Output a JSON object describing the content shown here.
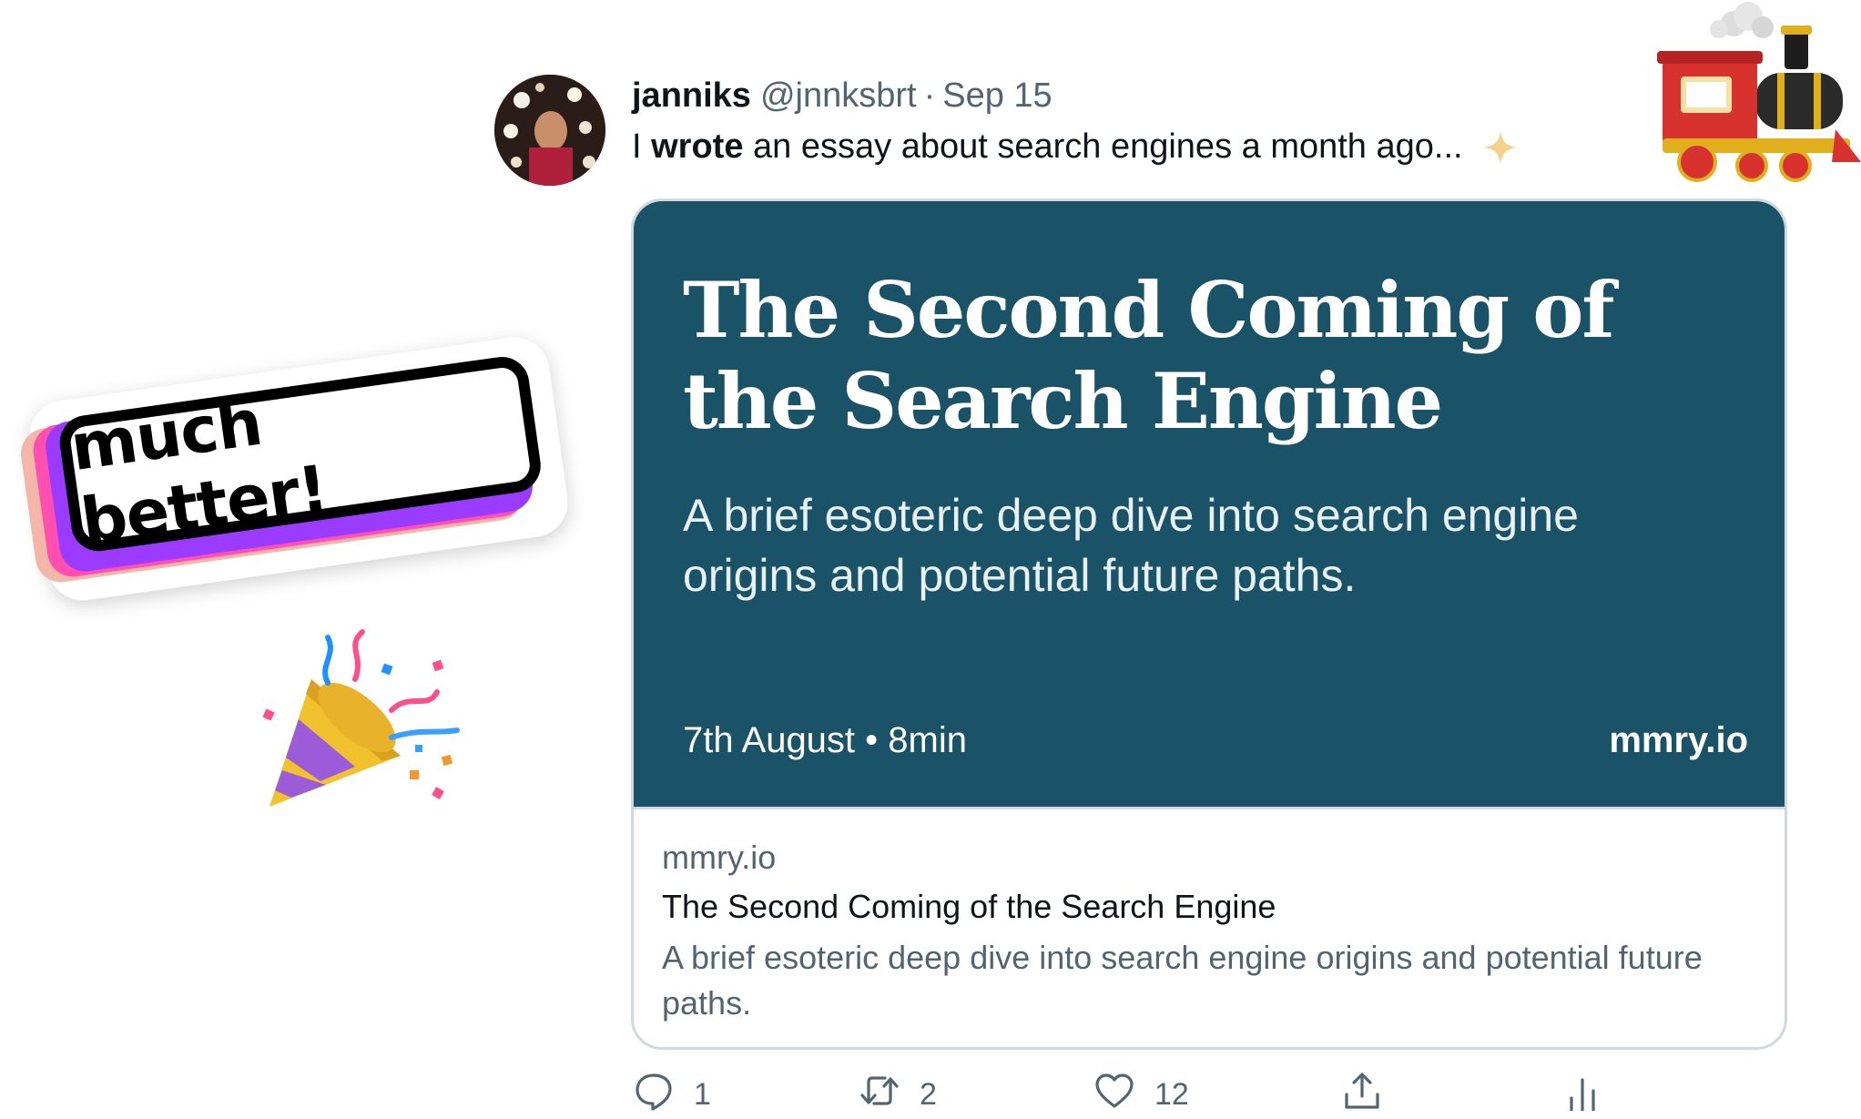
{
  "tweet": {
    "author_name": "janniks",
    "author_handle": "@jnnksbrt",
    "separator": "·",
    "date": "Sep 15",
    "text_before": "I ",
    "text_bold": "wrote",
    "text_after": " an essay about search engines a month ago..."
  },
  "card": {
    "image_title": "The Second Coming of the Search Engine",
    "image_subtitle": "A brief esoteric deep dive into search engine origins and potential future paths.",
    "image_meta": "7th August • 8min",
    "image_site": "mmry.io",
    "domain": "mmry.io",
    "title": "The Second Coming of the Search Engine",
    "description": "A brief esoteric deep dive into search engine origins and potential future paths."
  },
  "actions": {
    "reply_count": "1",
    "retweet_count": "2",
    "like_count": "12"
  },
  "stickers": {
    "badge_text": "much better!",
    "train_icon": "steam-locomotive-icon",
    "popper_icon": "party-popper-icon",
    "sparkle_icon": "sparkle-icon"
  },
  "colors": {
    "card_image_bg": "#1a5268",
    "secondary_text": "#536471",
    "primary_text": "#0f1419",
    "border": "#cfd9de",
    "sparkle": "#f7d08a",
    "badge_pink": "#ff4fb1",
    "badge_purple": "#9a3bff"
  }
}
